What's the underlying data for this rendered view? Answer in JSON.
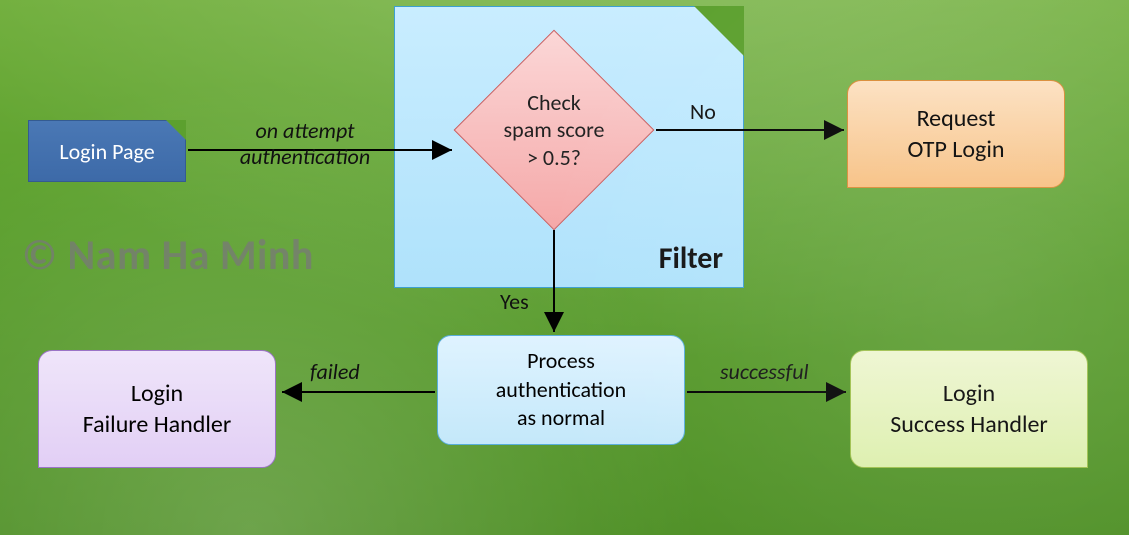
{
  "nodes": {
    "login_page": "Login Page",
    "filter": "Filter",
    "decision": "Check\nspam score\n> 0.5?",
    "otp": "Request\nOTP Login",
    "process": "Process\nauthentication\nas normal",
    "failure": "Login\nFailure Handler",
    "success": "Login\nSuccess Handler"
  },
  "edges": {
    "attempt": "on attempt\nauthentication",
    "no": "No",
    "yes": "Yes",
    "failed": "failed",
    "successful": "successful"
  },
  "watermark": "© Nam Ha Minh"
}
